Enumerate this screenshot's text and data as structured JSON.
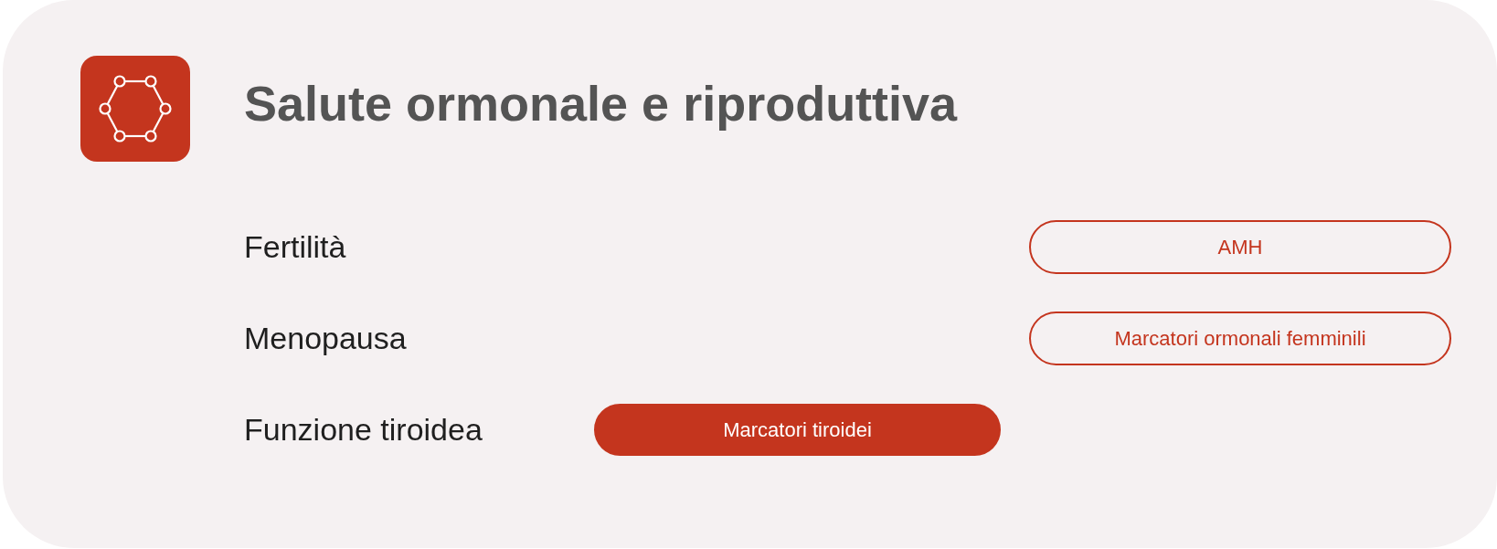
{
  "header": {
    "title": "Salute ormonale e riproduttiva"
  },
  "rows": [
    {
      "label": "Fertilità",
      "tests": [
        {
          "name": "AMH",
          "selected": false
        }
      ]
    },
    {
      "label": "Menopausa",
      "tests": [
        {
          "name": "Marcatori ormonali femminili",
          "selected": false
        }
      ]
    },
    {
      "label": "Funzione tiroidea",
      "tests": [
        {
          "name": "Marcatori tiroidei",
          "selected": true
        }
      ]
    }
  ]
}
